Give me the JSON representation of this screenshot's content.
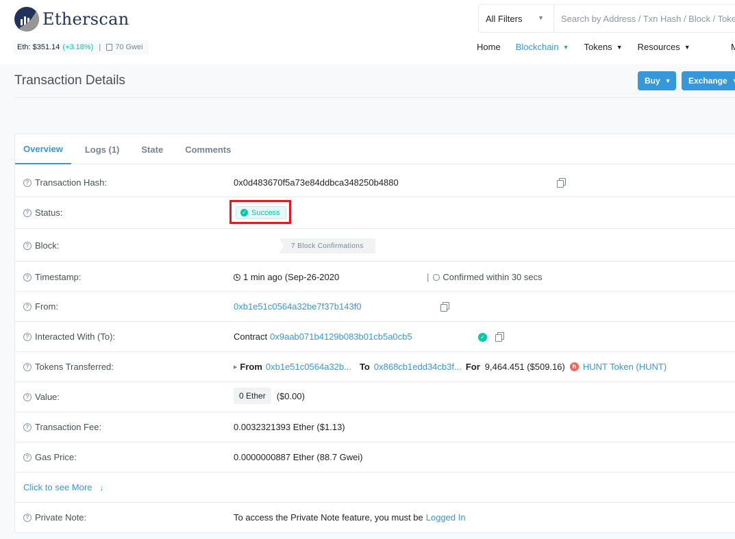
{
  "brand": {
    "name": "Etherscan"
  },
  "ticker": {
    "eth_price": "Eth: $351.14",
    "change": "(+3.18%)",
    "separator": "|",
    "gas": "70 Gwei"
  },
  "search": {
    "filter": "All Filters",
    "placeholder": "Search by Address / Txn Hash / Block / Token"
  },
  "nav": {
    "items": [
      {
        "label": "Home"
      },
      {
        "label": "Blockchain"
      },
      {
        "label": "Tokens"
      },
      {
        "label": "Resources"
      }
    ],
    "more": "M"
  },
  "page": {
    "title": "Transaction Details",
    "buy_label": "Buy",
    "exchange_label": "Exchange"
  },
  "tabs": [
    "Overview",
    "Logs (1)",
    "State",
    "Comments"
  ],
  "details": {
    "tx_hash": {
      "label": "Transaction Hash:",
      "value": "0x0d483670f5a73e84ddbca348250b4880"
    },
    "status": {
      "label": "Status:",
      "value": "Success"
    },
    "block": {
      "label": "Block:",
      "confirmations": "7 Block Confirmations"
    },
    "timestamp": {
      "label": "Timestamp:",
      "value": "1 min ago (Sep-26-2020",
      "separator": "|",
      "confirmed": "Confirmed within 30 secs"
    },
    "from": {
      "label": "From:",
      "value": "0xb1e51c0564a32be7f37b143f0"
    },
    "to": {
      "label": "Interacted With (To):",
      "prefix": "Contract",
      "value": "0x9aab071b4129b083b01cb5a0cb5"
    },
    "tokens": {
      "label": "Tokens Transferred:",
      "from_label": "From",
      "from": "0xb1e51c0564a32b...",
      "to_label": "To",
      "to": "0x868cb1edd34cb3f...",
      "for_label": "For",
      "amount": "9,464.451 ($509.16)",
      "token": "HUNT Token (HUNT)"
    },
    "value": {
      "label": "Value:",
      "ether": "0 Ether",
      "usd": "($0.00)"
    },
    "fee": {
      "label": "Transaction Fee:",
      "value": "0.0032321393 Ether ($1.13)"
    },
    "gas_price": {
      "label": "Gas Price:",
      "value": "0.0000000887 Ether (88.7 Gwei)"
    },
    "more": {
      "label": "Click to see More"
    },
    "private_note": {
      "label": "Private Note:",
      "text": "To access the Private Note feature, you must be",
      "link": "Logged In"
    }
  },
  "colors": {
    "accent": "#3498db",
    "success": "#00c9a7",
    "highlight": "#de1a24",
    "brand": "#21325b"
  }
}
